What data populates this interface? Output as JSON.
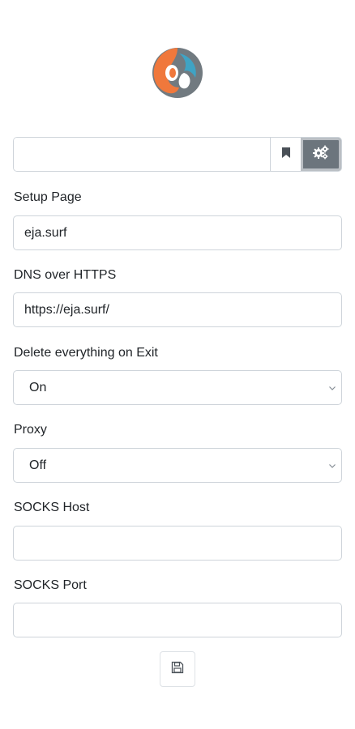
{
  "header": {
    "logo_icon": "eja-logo"
  },
  "address_bar": {
    "value": "",
    "bookmark_icon": "bookmark-icon",
    "settings_icon": "gears-icon"
  },
  "form": {
    "setup_page": {
      "label": "Setup Page",
      "value": "eja.surf"
    },
    "dns_over_https": {
      "label": "DNS over HTTPS",
      "value": "https://eja.surf/"
    },
    "delete_on_exit": {
      "label": "Delete everything on Exit",
      "selected": "On"
    },
    "proxy": {
      "label": "Proxy",
      "selected": "Off"
    },
    "socks_host": {
      "label": "SOCKS Host",
      "value": ""
    },
    "socks_port": {
      "label": "SOCKS Port",
      "value": ""
    },
    "save_icon": "floppy-disk-icon"
  },
  "colors": {
    "accent_button": "#6c757d",
    "logo_orange": "#f0783c",
    "logo_teal": "#3fa3c4",
    "logo_gray": "#717a80"
  }
}
